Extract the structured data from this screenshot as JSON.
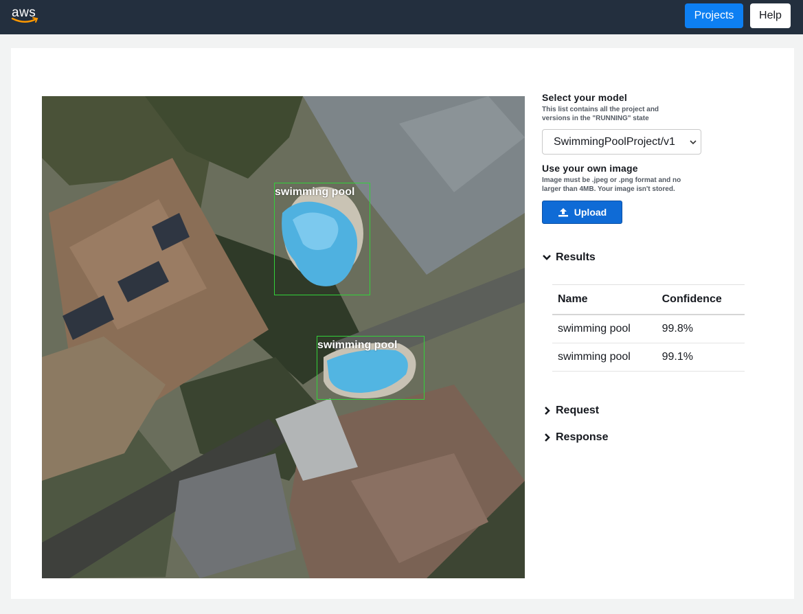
{
  "nav": {
    "logo_text": "aws",
    "projects_label": "Projects",
    "help_label": "Help"
  },
  "image": {
    "detections": [
      {
        "label": "swimming pool"
      },
      {
        "label": "swimming pool"
      }
    ]
  },
  "panel": {
    "model_heading": "Select your model",
    "model_hint": "This list contains all the project and versions in the \"RUNNING\" state",
    "model_selected": "SwimmingPoolProject/v1",
    "image_heading": "Use your own image",
    "image_hint": "Image must be .jpeg or .png format and no larger than 4MB. Your image isn't stored.",
    "upload_label": "Upload",
    "results_label": "Results",
    "request_label": "Request",
    "response_label": "Response",
    "table": {
      "headers": [
        "Name",
        "Confidence"
      ],
      "rows": [
        [
          "swimming pool",
          "99.8%"
        ],
        [
          "swimming pool",
          "99.1%"
        ]
      ]
    }
  },
  "colors": {
    "nav_bg": "#232f3e",
    "primary": "#0d7ff2",
    "upload": "#0f6bd6",
    "bbox": "#33d23a"
  },
  "icons": [
    "chevron-down-icon",
    "chevron-right-icon",
    "upload-icon",
    "aws-smile-icon"
  ]
}
